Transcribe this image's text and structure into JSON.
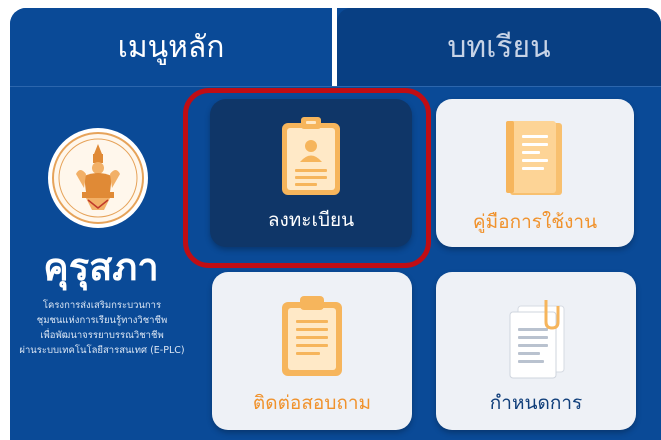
{
  "tabs": {
    "main_label": "เมนูหลัก",
    "lesson_label": "บทเรียน"
  },
  "sidebar": {
    "brand": "คุรุสภา",
    "description_lines": [
      "โครงการส่งเสริมกระบวนการ",
      "ชุมชนแห่งการเรียนรู้ทางวิชาชีพ",
      "เพื่อพัฒนาจรรยาบรรณวิชาชีพ",
      "ผ่านระบบเทคโนโลยีสารสนเทศ (E-PLC)"
    ]
  },
  "menu": {
    "register_label": "ลงทะเบียน",
    "manual_label": "คู่มือการใช้งาน",
    "contact_label": "ติดต่อสอบถาม",
    "schedule_label": "กำหนดการ"
  },
  "colors": {
    "background": "#0a4a97",
    "register_card": "#0f3668",
    "accent_orange": "#f0922c",
    "highlight_red": "#c00d14"
  },
  "icons": [
    "seal-logo-icon",
    "id-card-icon",
    "manual-book-icon",
    "clipboard-icon",
    "documents-clip-icon"
  ]
}
